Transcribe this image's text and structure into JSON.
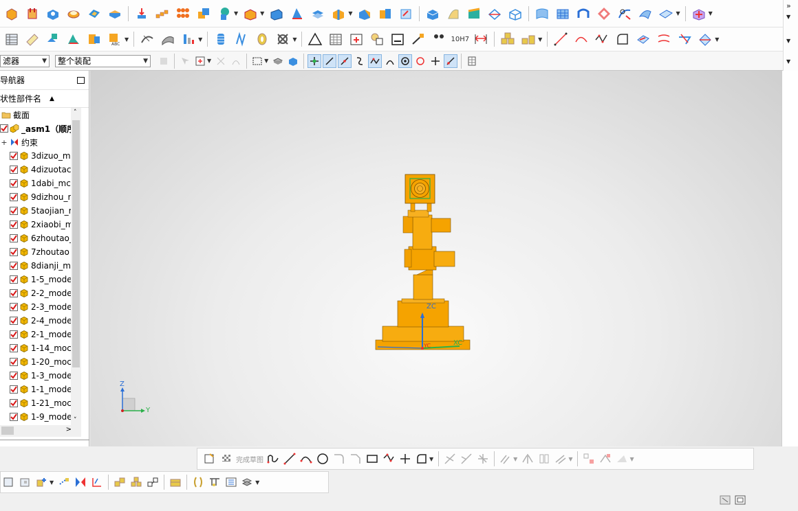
{
  "toolbars": {
    "top_right_more": "»",
    "assembly_hole_label": "10H7"
  },
  "filter_bar": {
    "filter_combo_value": "滤器",
    "scope_combo_value": "整个装配"
  },
  "navigator": {
    "title": "导航器",
    "column_header": "状性部件名",
    "items": [
      {
        "label": "截面",
        "type": "folder",
        "checked": false
      },
      {
        "label": "_asm1（顺序",
        "type": "assembly",
        "checked": true
      },
      {
        "label": "约束",
        "type": "constraints",
        "checked": false
      },
      {
        "label": "3dizuo_m",
        "type": "part",
        "checked": true
      },
      {
        "label": "4dizuotac",
        "type": "part",
        "checked": true
      },
      {
        "label": "1dabi_mc",
        "type": "part",
        "checked": true
      },
      {
        "label": "9dizhou_r",
        "type": "part",
        "checked": true
      },
      {
        "label": "5taojian_r",
        "type": "part",
        "checked": true
      },
      {
        "label": "2xiaobi_m",
        "type": "part",
        "checked": true
      },
      {
        "label": "6zhoutao_",
        "type": "part",
        "checked": true
      },
      {
        "label": "7zhoutao",
        "type": "part",
        "checked": true
      },
      {
        "label": "8dianji_m",
        "type": "part",
        "checked": true
      },
      {
        "label": "1-5_mode",
        "type": "part",
        "checked": true
      },
      {
        "label": "2-2_mode",
        "type": "part",
        "checked": true
      },
      {
        "label": "2-3_mode",
        "type": "part",
        "checked": true
      },
      {
        "label": "2-4_mode",
        "type": "part",
        "checked": true
      },
      {
        "label": "2-1_mode",
        "type": "part",
        "checked": true
      },
      {
        "label": "1-14_moc",
        "type": "part",
        "checked": true
      },
      {
        "label": "1-20_moc",
        "type": "part",
        "checked": true
      },
      {
        "label": "1-3_mode",
        "type": "part",
        "checked": true
      },
      {
        "label": "1-1_mode",
        "type": "part",
        "checked": true
      },
      {
        "label": "1-21_moc",
        "type": "part",
        "checked": true
      },
      {
        "label": "1-9_mode",
        "type": "part",
        "checked": true
      }
    ]
  },
  "viewport": {
    "wcs_labels": {
      "z": "ZC",
      "x": "XC",
      "y": "YC"
    },
    "triad_labels": {
      "z": "Z",
      "y": "Y"
    },
    "model_color": "#f5a300"
  },
  "sketch_bar": {
    "finish_sketch_label": "完成草图"
  },
  "colors": {
    "accent": "#2a6fd6",
    "part_yellow": "#f2b600",
    "check_red": "#d81818"
  }
}
